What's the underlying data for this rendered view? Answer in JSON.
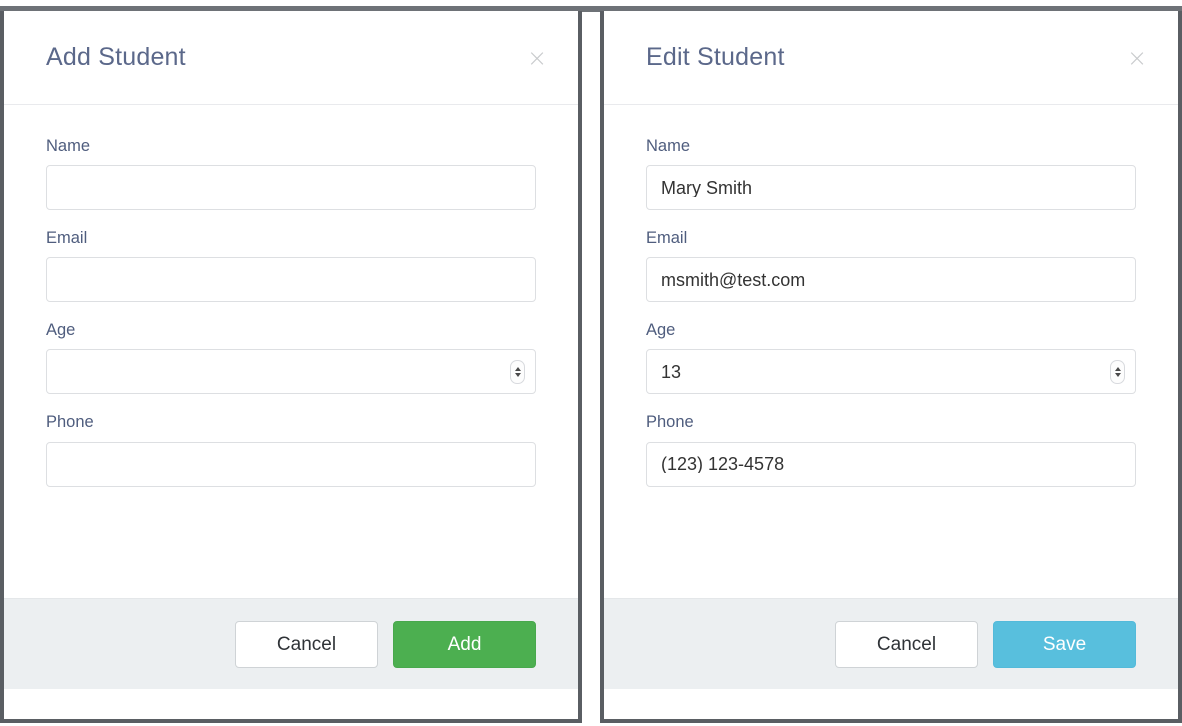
{
  "page": {
    "background": "#ffffff",
    "accent_green": "#4caf50",
    "accent_blue": "#58bfdd",
    "label_color": "#4f5d7e",
    "title_color": "#5b688a",
    "footer_background": "#eceff1",
    "frame_color": "#5a5e63"
  },
  "panels": [
    {
      "id": "add-student",
      "header": {
        "title": "Add Student",
        "close_icon": "close-icon",
        "close_glyph": "×"
      },
      "fields": [
        {
          "name": "name",
          "label": "Name",
          "value": "",
          "placeholder": "",
          "type": "text"
        },
        {
          "name": "email",
          "label": "Email",
          "value": "",
          "placeholder": "",
          "type": "text"
        },
        {
          "name": "age",
          "label": "Age",
          "value": "",
          "placeholder": "",
          "type": "number"
        },
        {
          "name": "phone",
          "label": "Phone",
          "value": "",
          "placeholder": "",
          "type": "text"
        }
      ],
      "footer": {
        "cancel_label": "Cancel",
        "submit_label": "Add",
        "submit_color": "#4caf50"
      }
    },
    {
      "id": "edit-student",
      "header": {
        "title": "Edit Student",
        "close_icon": "close-icon",
        "close_glyph": "×"
      },
      "fields": [
        {
          "name": "name",
          "label": "Name",
          "value": "Mary Smith",
          "placeholder": "",
          "type": "text"
        },
        {
          "name": "email",
          "label": "Email",
          "value": "msmith@test.com",
          "placeholder": "",
          "type": "text"
        },
        {
          "name": "age",
          "label": "Age",
          "value": "13",
          "placeholder": "",
          "type": "number"
        },
        {
          "name": "phone",
          "label": "Phone",
          "value": "(123) 123-4578",
          "placeholder": "",
          "type": "text"
        }
      ],
      "footer": {
        "cancel_label": "Cancel",
        "submit_label": "Save",
        "submit_color": "#58bfdd"
      }
    }
  ]
}
